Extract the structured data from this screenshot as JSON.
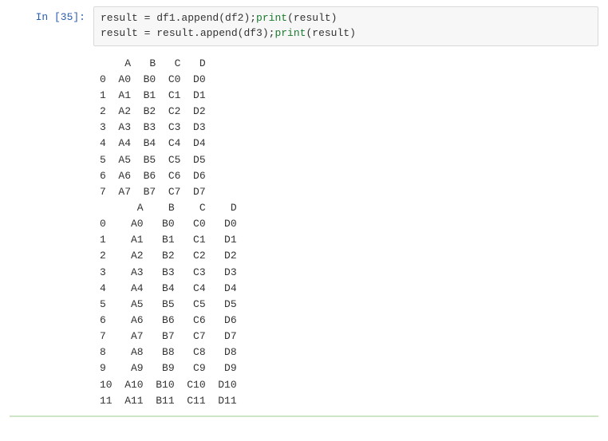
{
  "prompt": "In  [35]:",
  "code": {
    "line1_a": "result = df1.",
    "line1_b": "append",
    "line1_c": "(df2);",
    "line1_print": "print",
    "line1_d": "(result)",
    "line2_a": "result = result.",
    "line2_b": "append",
    "line2_c": "(df3);",
    "line2_print": "print",
    "line2_d": "(result)"
  },
  "output_text": "    A   B   C   D\n0  A0  B0  C0  D0\n1  A1  B1  C1  D1\n2  A2  B2  C2  D2\n3  A3  B3  C3  D3\n4  A4  B4  C4  D4\n5  A5  B5  C5  D5\n6  A6  B6  C6  D6\n7  A7  B7  C7  D7\n      A    B    C    D\n0    A0   B0   C0   D0\n1    A1   B1   C1   D1\n2    A2   B2   C2   D2\n3    A3   B3   C3   D3\n4    A4   B4   C4   D4\n5    A5   B5   C5   D5\n6    A6   B6   C6   D6\n7    A7   B7   C7   D7\n8    A8   B8   C8   D8\n9    A9   B9   C9   D9\n10  A10  B10  C10  D10\n11  A11  B11  C11  D11"
}
